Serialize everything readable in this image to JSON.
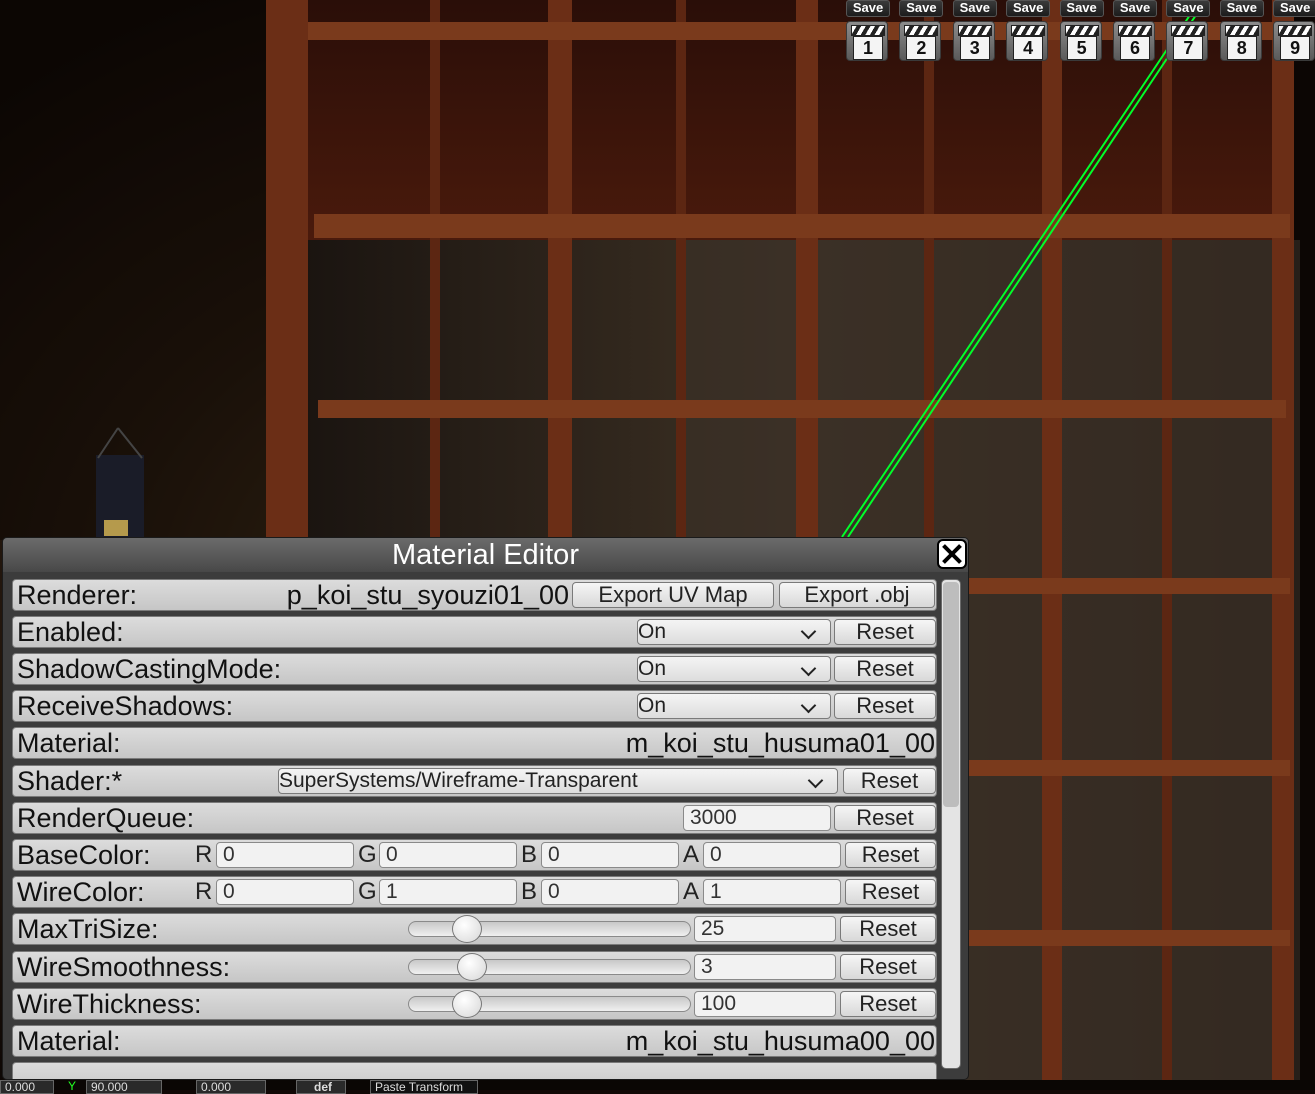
{
  "save_slots": [
    {
      "label": "Save",
      "number": "1"
    },
    {
      "label": "Save",
      "number": "2"
    },
    {
      "label": "Save",
      "number": "3"
    },
    {
      "label": "Save",
      "number": "4"
    },
    {
      "label": "Save",
      "number": "5"
    },
    {
      "label": "Save",
      "number": "6"
    },
    {
      "label": "Save",
      "number": "7"
    },
    {
      "label": "Save",
      "number": "8"
    },
    {
      "label": "Save",
      "number": "9"
    }
  ],
  "editor": {
    "title": "Material Editor",
    "close_icon": "close-icon",
    "renderer": {
      "label": "Renderer:",
      "value": "p_koi_stu_syouzi01_00",
      "export_uv_label": "Export UV Map",
      "export_obj_label": "Export .obj"
    },
    "enabled": {
      "label": "Enabled:",
      "value": "On",
      "reset": "Reset"
    },
    "shadow_casting": {
      "label": "ShadowCastingMode:",
      "value": "On",
      "reset": "Reset"
    },
    "receive_shadows": {
      "label": "ReceiveShadows:",
      "value": "On",
      "reset": "Reset"
    },
    "material_1": {
      "label": "Material:",
      "value": "m_koi_stu_husuma01_00"
    },
    "shader": {
      "label": "Shader:*",
      "value": "SuperSystems/Wireframe-Transparent",
      "reset": "Reset"
    },
    "render_queue": {
      "label": "RenderQueue:",
      "value": "3000",
      "reset": "Reset"
    },
    "base_color": {
      "label": "BaseColor:",
      "r_label": "R",
      "r": "0",
      "g_label": "G",
      "g": "0",
      "b_label": "B",
      "b": "0",
      "a_label": "A",
      "a": "0",
      "reset": "Reset"
    },
    "wire_color": {
      "label": "WireColor:",
      "r_label": "R",
      "r": "0",
      "g_label": "G",
      "g": "1",
      "b_label": "B",
      "b": "0",
      "a_label": "A",
      "a": "1",
      "reset": "Reset"
    },
    "max_tri_size": {
      "label": "MaxTriSize:",
      "value": "25",
      "slider_fraction": 0.17,
      "reset": "Reset"
    },
    "wire_smoothness": {
      "label": "WireSmoothness:",
      "value": "3",
      "slider_fraction": 0.19,
      "reset": "Reset"
    },
    "wire_thickness": {
      "label": "WireThickness:",
      "value": "100",
      "slider_fraction": 0.17,
      "reset": "Reset"
    },
    "material_2": {
      "label": "Material:",
      "value": "m_koi_stu_husuma00_00"
    }
  },
  "status_bar": {
    "x_value": "0.000",
    "y_label": "Y",
    "y_value": "90.000",
    "z_value": "0.000",
    "def_label": "def",
    "paste_transform_label": "Paste Transform"
  },
  "colors": {
    "wireframe": "#00ff2a",
    "panel_bg": "#3c3c3c",
    "row_bg": "#d4d4d4"
  }
}
